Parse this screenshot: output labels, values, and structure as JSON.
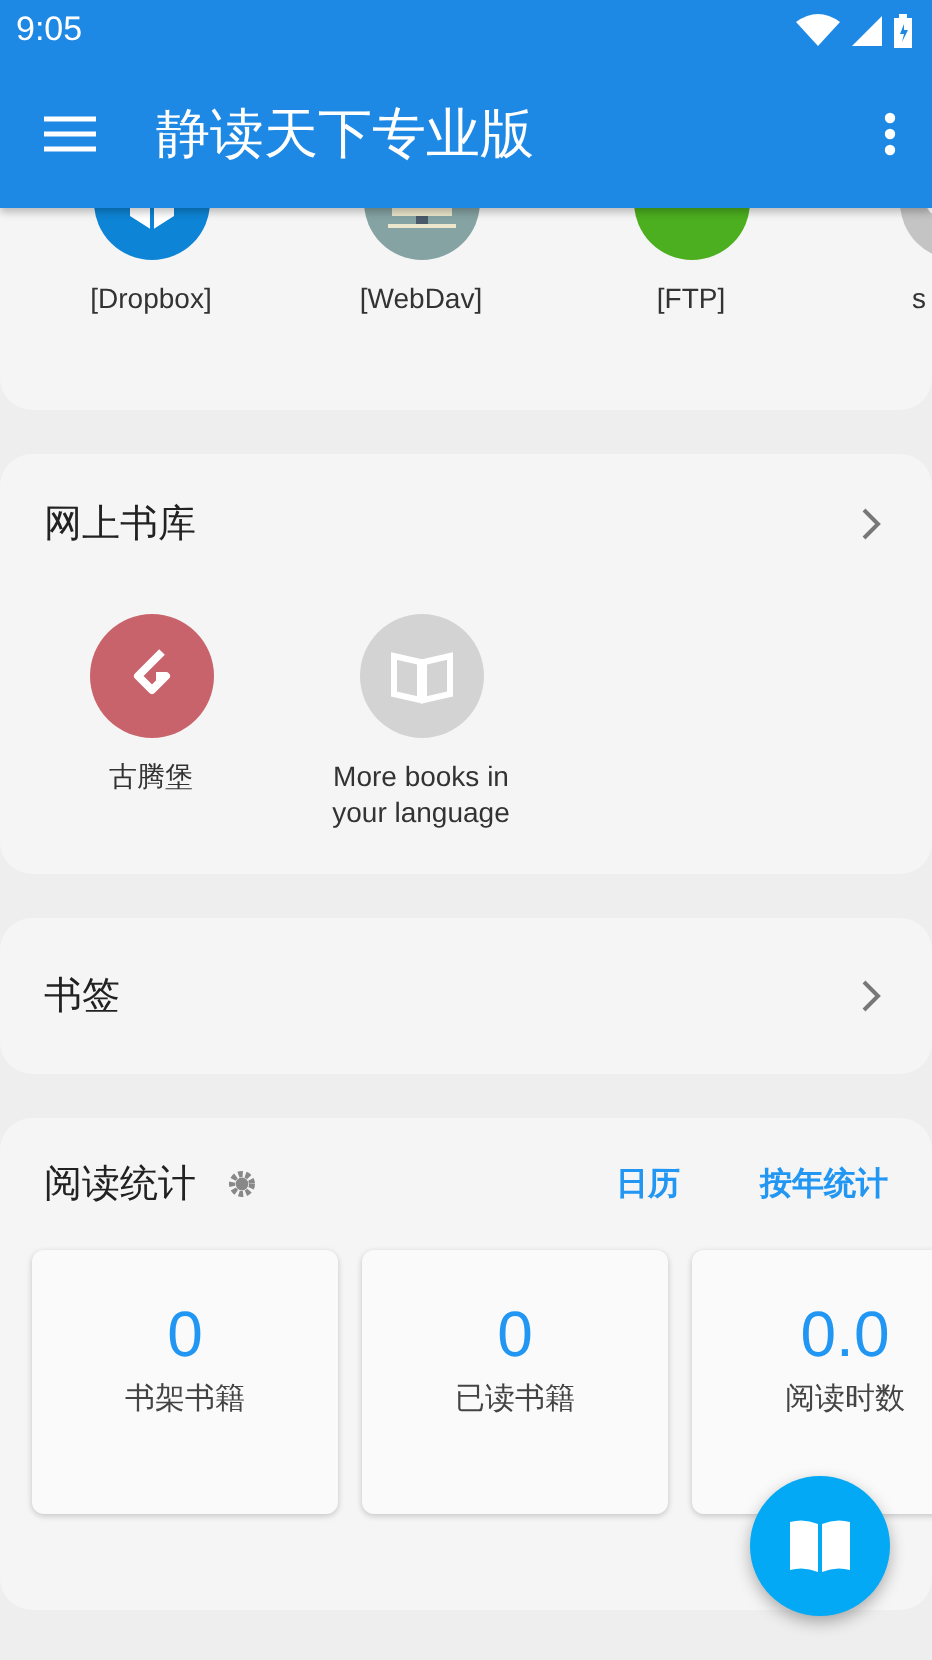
{
  "status_bar": {
    "time": "9:05"
  },
  "app_bar": {
    "title": "静读天下专业版"
  },
  "cloud_storage": {
    "items": [
      {
        "label": "[Dropbox]",
        "kind": "dropbox"
      },
      {
        "label": "[WebDav]",
        "kind": "webdav"
      },
      {
        "label": "[FTP]",
        "kind": "ftp"
      },
      {
        "label": "s",
        "kind": "other"
      }
    ]
  },
  "online_library": {
    "title": "网上书库",
    "items": [
      {
        "label": "古腾堡",
        "kind": "gutenberg"
      },
      {
        "label": "More books in your language",
        "kind": "books"
      }
    ]
  },
  "bookmarks": {
    "title": "书签"
  },
  "reading_stats": {
    "title": "阅读统计",
    "links": [
      "日历",
      "按年统计"
    ],
    "stats": [
      {
        "value": "0",
        "label": "书架书籍"
      },
      {
        "value": "0",
        "label": "已读书籍"
      },
      {
        "value": "0.0",
        "label": "阅读时数"
      }
    ]
  }
}
